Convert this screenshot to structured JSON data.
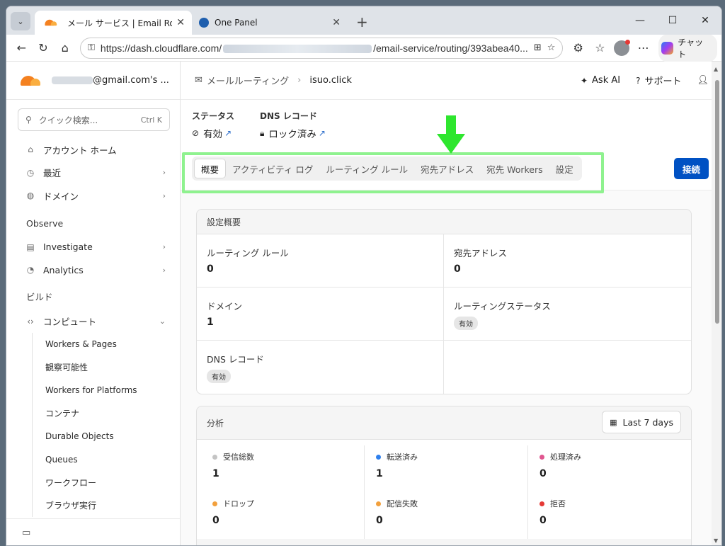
{
  "browser": {
    "tabs": [
      {
        "title": "メール サービス | Email Routing | Clou",
        "close": "✕"
      },
      {
        "title": "One Panel",
        "close": "✕"
      }
    ],
    "url_prefix": "https://dash.cloudflare.com/",
    "url_suffix": "/email-service/routing/393abea40...",
    "copilot_label": "チャット"
  },
  "sidebar": {
    "account_suffix": "@gmail.com's ...",
    "search_placeholder": "クイック検索...",
    "search_shortcut": "Ctrl K",
    "items_top": [
      {
        "label": "アカウント ホーム"
      },
      {
        "label": "最近"
      },
      {
        "label": "ドメイン"
      }
    ],
    "section_observe": "Observe",
    "items_observe": [
      {
        "label": "Investigate"
      },
      {
        "label": "Analytics"
      }
    ],
    "section_build": "ビルド",
    "compute_label": "コンピュート",
    "sub_items": [
      {
        "label": "Workers & Pages"
      },
      {
        "label": "観察可能性"
      },
      {
        "label": "Workers for Platforms"
      },
      {
        "label": "コンテナ"
      },
      {
        "label": "Durable Objects"
      },
      {
        "label": "Queues"
      },
      {
        "label": "ワークフロー"
      },
      {
        "label": "ブラウザ実行"
      }
    ]
  },
  "header": {
    "breadcrumb_root": "メールルーティング",
    "breadcrumb_current": "isuo.click",
    "ask_ai": "Ask AI",
    "support": "サポート"
  },
  "status": {
    "status_label": "ステータス",
    "status_value": "有効",
    "dns_label": "DNS レコード",
    "dns_value": "ロック済み"
  },
  "tabs": [
    {
      "label": "概要"
    },
    {
      "label": "アクティビティ ログ"
    },
    {
      "label": "ルーティング ルール"
    },
    {
      "label": "宛先アドレス"
    },
    {
      "label": "宛先 Workers"
    },
    {
      "label": "設定"
    }
  ],
  "connect_label": "接続",
  "overview": {
    "title": "設定概要",
    "routing_rules_label": "ルーティング ルール",
    "routing_rules_value": "0",
    "destinations_label": "宛先アドレス",
    "destinations_value": "0",
    "domains_label": "ドメイン",
    "domains_value": "1",
    "routing_status_label": "ルーティングステータス",
    "routing_status_badge": "有効",
    "dns_label": "DNS レコード",
    "dns_badge": "有効"
  },
  "analytics": {
    "title": "分析",
    "range": "Last 7 days",
    "metrics": [
      {
        "label": "受信総数",
        "value": "1",
        "color": "#c4c4c4"
      },
      {
        "label": "転送済み",
        "value": "1",
        "color": "#2f80ed"
      },
      {
        "label": "処理済み",
        "value": "0",
        "color": "#e0568f"
      },
      {
        "label": "ドロップ",
        "value": "0",
        "color": "#f2a03d"
      },
      {
        "label": "配信失敗",
        "value": "0",
        "color": "#f2a03d"
      },
      {
        "label": "拒否",
        "value": "0",
        "color": "#e53935"
      }
    ]
  },
  "colors": {
    "accent": "#0051c3",
    "highlight": "#8ff28f",
    "arrow": "#2ee62e",
    "brand": "#f48120"
  }
}
